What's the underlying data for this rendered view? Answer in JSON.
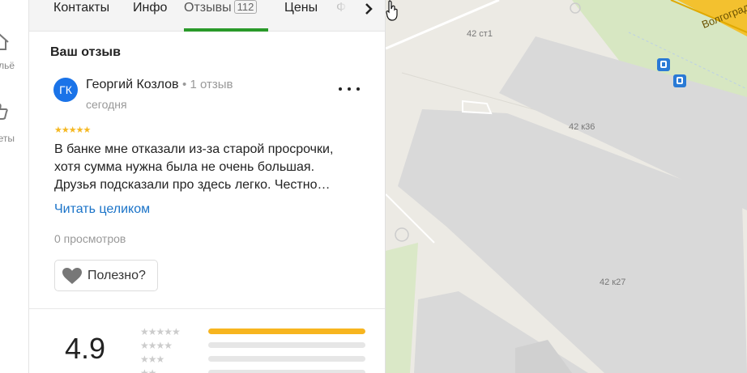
{
  "rail": {
    "items": [
      {
        "label": "льё",
        "icon": "house-icon"
      },
      {
        "label": "еты",
        "icon": "thumbs-up-icon"
      }
    ]
  },
  "tabs": {
    "items": [
      {
        "label": "Контакты",
        "state": "normal"
      },
      {
        "label": "Инфо",
        "state": "normal"
      },
      {
        "label": "Отзывы",
        "count": "112",
        "state": "active"
      },
      {
        "label": "Цены",
        "state": "normal"
      },
      {
        "label": "Ф",
        "state": "faded"
      }
    ],
    "next_icon": "chevron-right-icon"
  },
  "review": {
    "section_title": "Ваш отзыв",
    "avatar_initials": "ГК",
    "author": "Георгий Козлов",
    "author_reviews": "1 отзыв",
    "date": "сегодня",
    "rating": 5,
    "stars": "★★★★★",
    "text_lines": [
      "В банке мне отказали из-за старой просрочки,",
      "хотя сумма нужна была не очень большая.",
      "Друзья подсказали про здесь легко. Честно…"
    ],
    "read_more": "Читать целиком",
    "views": "0 просмотров",
    "useful_label": "Полезно?"
  },
  "summary": {
    "score": "4.9",
    "rows": [
      {
        "stars": "★★★★★",
        "fraction": 1.0
      },
      {
        "stars": "★★★★",
        "fraction": 0.0
      },
      {
        "stars": "★★★",
        "fraction": 0.0
      },
      {
        "stars": "★★",
        "fraction": 0.0
      }
    ]
  },
  "map": {
    "labels": [
      "42 ст1",
      "42 к36",
      "42 к27"
    ],
    "road_name": "Волгоград",
    "colors": {
      "background": "#eceae4",
      "building": "#d9d9d9",
      "green": "#cfe6b4",
      "road": "#f3c12f"
    }
  },
  "colors": {
    "accent_blue": "#1a73e8",
    "tab_underline": "#2a9a2a",
    "star": "#f5b822",
    "bar_fill": "#f7b51f"
  }
}
